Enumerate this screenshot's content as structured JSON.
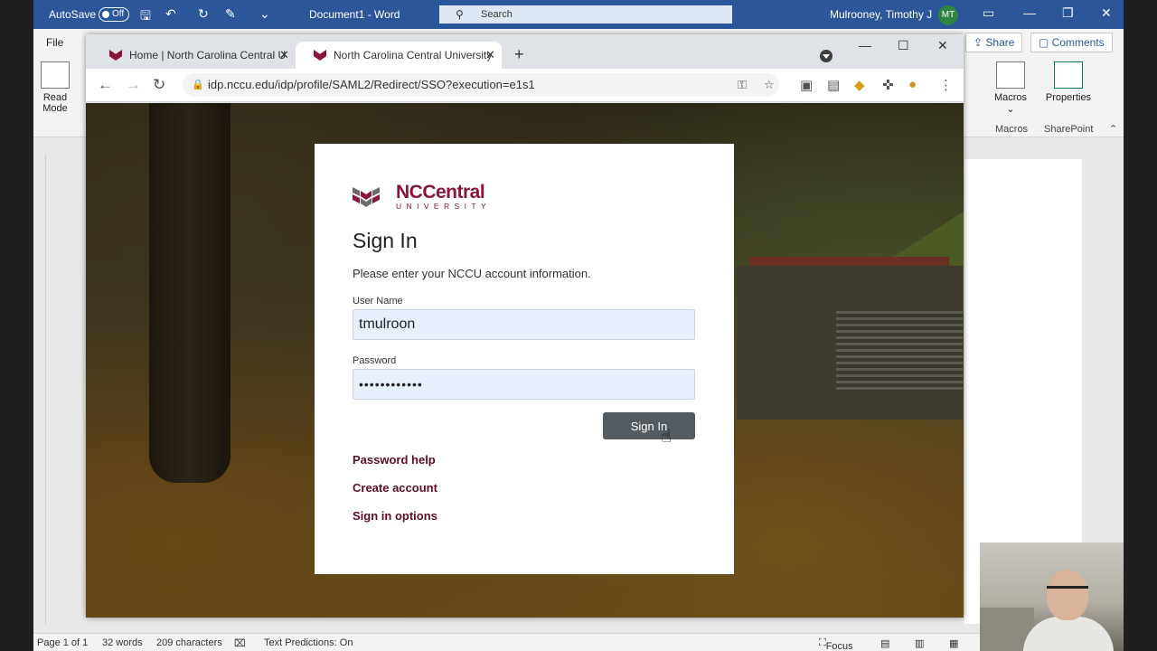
{
  "word": {
    "autosave_label": "AutoSave",
    "autosave_state": "Off",
    "doc_title": "Document1 - Word",
    "search_placeholder": "Search",
    "user_name": "Mulrooney, Timothy J",
    "user_initials": "MT",
    "file_tab": "File",
    "share_label": "Share",
    "comments_label": "Comments",
    "read_mode_label_1": "Read",
    "read_mode_label_2": "Mode",
    "macros_label": "Macros",
    "properties_label": "Properties",
    "macros_group": "Macros",
    "sharepoint_group": "SharePoint",
    "status": {
      "page": "Page 1 of 1",
      "words": "32 words",
      "characters": "209 characters",
      "text_predictions": "Text Predictions: On",
      "focus": "Focus"
    }
  },
  "browser": {
    "tabs": [
      {
        "title": "Home | North Carolina Central U"
      },
      {
        "title": "North Carolina Central University"
      }
    ],
    "url": "idp.nccu.edu/idp/profile/SAML2/Redirect/SSO?execution=e1s1"
  },
  "login": {
    "logo_name": "NCCentral",
    "logo_sub": "UNIVERSITY",
    "heading": "Sign In",
    "intro": "Please enter your NCCU account information.",
    "username_label": "User Name",
    "username_value": "tmulroon",
    "password_label": "Password",
    "password_value": "••••••••••••",
    "signin_button": "Sign In",
    "links": [
      "Password help",
      "Create account",
      "Sign in options"
    ]
  },
  "colors": {
    "word_blue": "#2b579a",
    "nccu_maroon": "#8a1538",
    "link_maroon": "#5b0f1f",
    "signin_gray": "#535a60"
  }
}
